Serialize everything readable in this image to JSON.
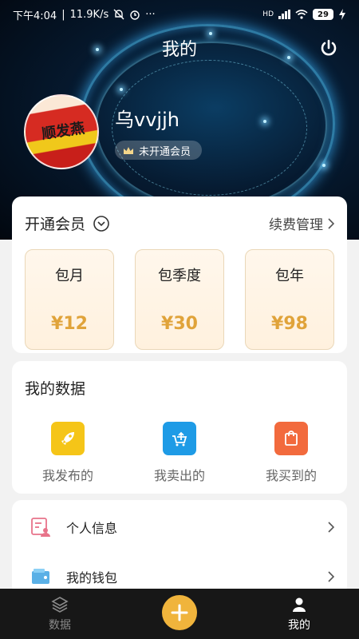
{
  "status_bar": {
    "time": "下午4:04",
    "speed": "11.9K/s",
    "more": "···",
    "network": "HD",
    "battery": "29"
  },
  "header": {
    "title": "我的",
    "username": "乌vvjjh",
    "member_status": "未开通会员",
    "avatar_text": "顺发燕"
  },
  "vip": {
    "title": "开通会员",
    "renew_label": "续费管理",
    "plans": [
      {
        "name": "包月",
        "price": "¥12"
      },
      {
        "name": "包季度",
        "price": "¥30"
      },
      {
        "name": "包年",
        "price": "¥98"
      }
    ]
  },
  "my_data": {
    "title": "我的数据",
    "items": [
      {
        "label": "我发布的",
        "icon": "rocket-icon",
        "color": "#f5c518"
      },
      {
        "label": "我卖出的",
        "icon": "upload-cart-icon",
        "color": "#1e9be6"
      },
      {
        "label": "我买到的",
        "icon": "shopping-bag-icon",
        "color": "#f26a3d"
      }
    ]
  },
  "menu": {
    "items": [
      {
        "label": "个人信息",
        "icon": "profile-card-icon"
      },
      {
        "label": "我的钱包",
        "icon": "wallet-icon"
      }
    ]
  },
  "bottom_nav": {
    "items": [
      {
        "label": "数据",
        "icon": "layers-icon",
        "active": false
      },
      {
        "label": "",
        "icon": "plus-icon"
      },
      {
        "label": "我的",
        "icon": "person-icon",
        "active": true
      }
    ]
  },
  "colors": {
    "accent": "#f0b43c",
    "price": "#e0a33a",
    "nav_bg": "#171717"
  }
}
